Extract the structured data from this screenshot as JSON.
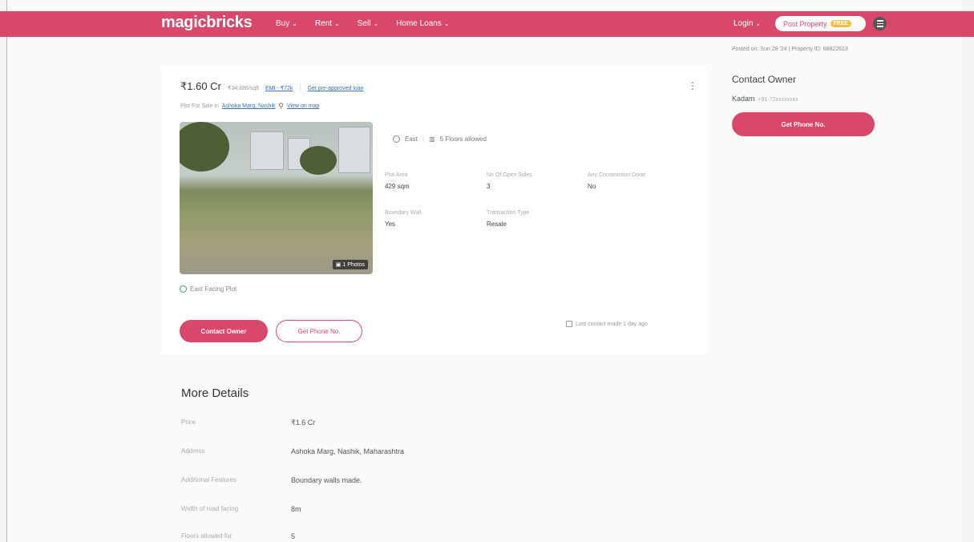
{
  "header": {
    "logo": "magicbricks",
    "nav": [
      {
        "label": "Buy"
      },
      {
        "label": "Rent"
      },
      {
        "label": "Sell"
      },
      {
        "label": "Home Loans"
      }
    ],
    "login_label": "Login",
    "post_property_label": "Post Property",
    "free_badge": "FREE",
    "menu_icon": "hamburger-icon"
  },
  "meta": {
    "posted": "Posted on: Sun 28 '24   |   Property ID: 68822613"
  },
  "listing": {
    "price": "₹1.60 Cr",
    "price_per_sqft": "₹34,886/sqft",
    "emi": "EMI - ₹72k",
    "separator": "|",
    "loan_link": "Get pre-approved loan",
    "subtitle_prefix": "Plot For Sale in",
    "locality_link": "Ashoka Marg, Nashik",
    "map_link": "View on map",
    "photo_count": "1 Photos",
    "facing": "East",
    "floors_allowed": "5 Floors allowed",
    "attributes": [
      {
        "label": "Plot Area",
        "value": "429 sqm"
      },
      {
        "label": "No Of Open Sides",
        "value": "3"
      },
      {
        "label": "Any Construction Done",
        "value": "No"
      },
      {
        "label": "Boundary Wall",
        "value": "Yes"
      },
      {
        "label": "Transaction Type",
        "value": "Resale"
      }
    ],
    "highlight": "East Facing Plot",
    "contact_owner_btn": "Contact Owner",
    "get_phone_btn": "Get Phone No.",
    "last_contact": "Last contact made 1 day ago"
  },
  "contact_panel": {
    "title": "Contact Owner",
    "owner_name": "Kadam",
    "phone_mask": "+91-72xxxxxxxx",
    "button": "Get Phone No."
  },
  "more_details": {
    "title": "More Details",
    "rows": [
      {
        "label": "Price",
        "value": "₹1.6 Cr"
      },
      {
        "label": "Address",
        "value": "Ashoka Marg, Nashik, Maharashtra"
      },
      {
        "label": "Additional Features",
        "value": "Boundary walls made."
      },
      {
        "label": "Width of road facing",
        "value": "8m"
      },
      {
        "label": "Floors allowed for",
        "value": "5"
      }
    ]
  },
  "colors": {
    "brand": "#d9476a",
    "link": "#3a6fb0"
  }
}
